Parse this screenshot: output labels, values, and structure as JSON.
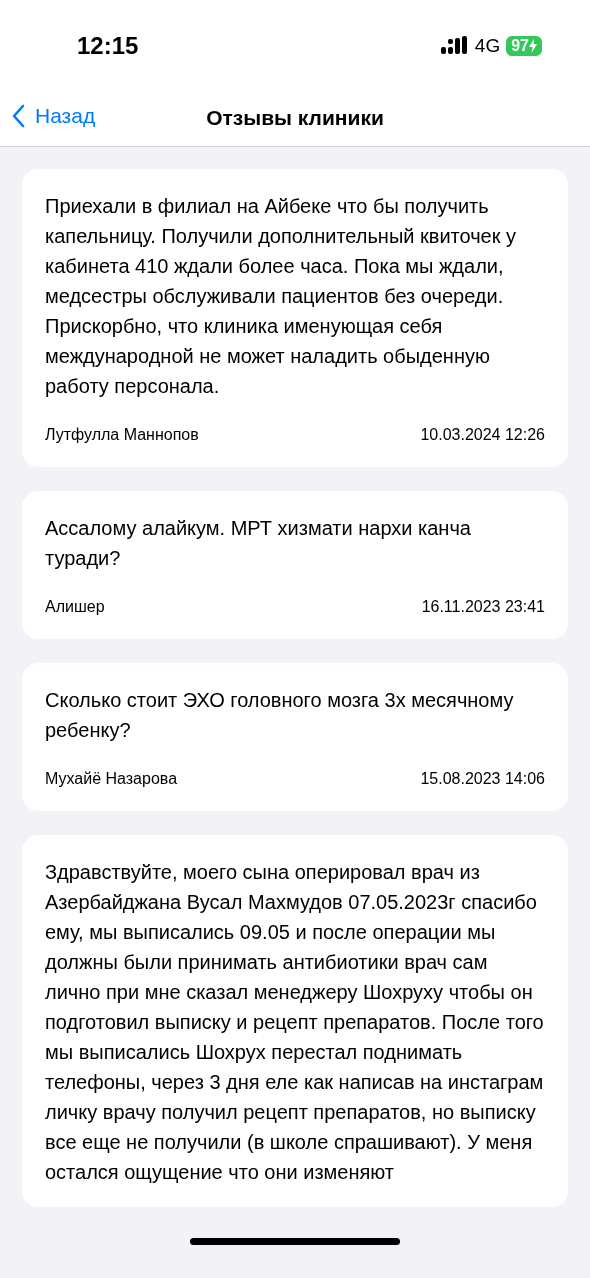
{
  "status_bar": {
    "time": "12:15",
    "network": "4G",
    "battery": "97"
  },
  "nav": {
    "back": "Назад",
    "title": "Отзывы клиники"
  },
  "reviews": [
    {
      "text": "Приехали в филиал на Айбеке что бы получить капельницу. Получили дополнительный квиточек у кабинета 410 ждали более часа. Пока мы ждали, медсестры обслуживали пациентов без очереди. Прискорбно, что клиника именующая себя международной не может наладить обыденную работу персонала.",
      "author": "Лутфулла Маннопов",
      "date": "10.03.2024 12:26"
    },
    {
      "text": "Ассалому алайкум. МРТ хизмати нархи канча туради?",
      "author": "Алишер",
      "date": "16.11.2023 23:41"
    },
    {
      "text": "Сколько стоит ЭХО головного мозга 3х месячному ребенку?",
      "author": "Мухайё Назарова",
      "date": "15.08.2023 14:06"
    },
    {
      "text": "Здравствуйте, моего сына оперировал врач из Азербайджана Вусал Махмудов 07.05.2023г спасибо ему, мы выписались 09.05 и после операции мы должны были принимать антибиотики врач сам лично при мне сказал менеджеру Шохруху чтобы он подготовил выписку и рецепт препаратов. После того мы выписались Шохрух перестал поднимать телефоны, через 3 дня еле как написав на инстаграм личку врачу получил рецепт препаратов, но выписку все еще не получили (в школе спрашивают). У меня остался ощущение что они изменяют"
    }
  ]
}
